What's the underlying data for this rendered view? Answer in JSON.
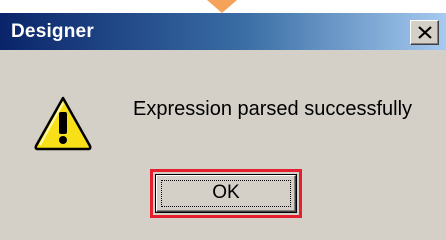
{
  "window": {
    "title": "Designer",
    "close_icon": "close-icon"
  },
  "message": {
    "icon": "warning-icon",
    "text": "Expression parsed successfully"
  },
  "buttons": {
    "ok_label": "OK"
  },
  "colors": {
    "titlebar_start": "#0a246a",
    "titlebar_end": "#a6caf0",
    "dialog_bg": "#d4d0c8",
    "highlight": "#e5202e",
    "warning_yellow": "#f7e017"
  }
}
